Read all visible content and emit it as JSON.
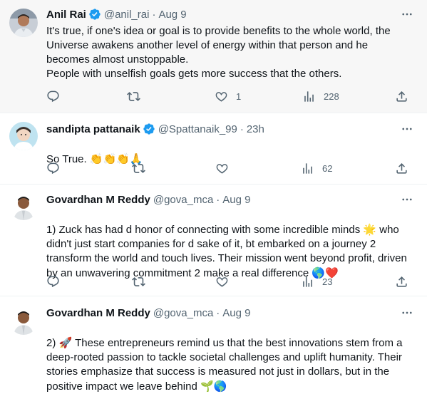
{
  "tweets": [
    {
      "name": "Anil Rai",
      "handle": "@anil_rai",
      "sep": "·",
      "time": "Aug 9",
      "verified": true,
      "text": "It's true, if one's idea or goal is to provide benefits to the whole world, the Universe awakens another level of energy within that person and he becomes almost unstoppable.\nPeople with unselfish goals gets more success that the others.",
      "reply_count": "",
      "retweet_count": "",
      "like_count": "1",
      "view_count": "228"
    },
    {
      "name": "sandipta pattanaik",
      "handle": "@Spattanaik_99",
      "sep": "·",
      "time": "23h",
      "verified": true,
      "text_main": "So True. ",
      "text_emoji": "👏👏👏🙏",
      "reply_count": "",
      "retweet_count": "",
      "like_count": "",
      "view_count": "62"
    },
    {
      "name": "Govardhan M Reddy",
      "handle": "@gova_mca",
      "sep": "·",
      "time": "Aug 9",
      "verified": false,
      "text_a": "1) Zuck has had d honor of connecting with some incredible minds ",
      "emoji_a": "🌟",
      "text_b": " who didn't just start companies for d sake of it, bt embarked on a journey 2 transform the world and touch lives. Their mission went beyond profit, driven by an unwavering commitment 2 make a real difference ",
      "emoji_b": "🌎❤️",
      "reply_count": "",
      "retweet_count": "",
      "like_count": "",
      "view_count": "23"
    },
    {
      "name": "Govardhan M Reddy",
      "handle": "@gova_mca",
      "sep": "·",
      "time": "Aug 9",
      "verified": false,
      "text_a": "2) ",
      "emoji_a": "🚀",
      "text_b": " These entrepreneurs remind us that the best innovations stem from a deep-rooted passion to tackle societal challenges and uplift humanity. Their stories emphasize that success is measured not just in dollars, but in the positive impact we leave behind ",
      "emoji_b": "🌱🌎"
    }
  ],
  "colors": {
    "text": "#0f1419",
    "secondary": "#536471",
    "verified": "#1d9bf0",
    "highlight_bg": "#f7f7f7",
    "divider": "#eff3f4"
  },
  "icons": [
    "reply-icon",
    "retweet-icon",
    "like-icon",
    "views-icon",
    "share-icon",
    "more-icon",
    "verified-badge-icon"
  ]
}
